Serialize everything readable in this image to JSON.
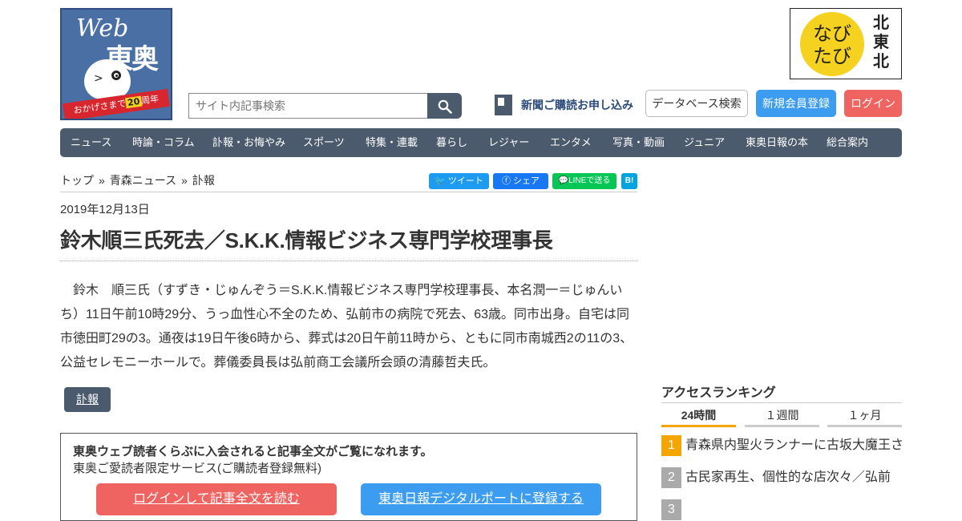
{
  "logo": {
    "web": "Web",
    "name": "東奥",
    "ribbon_before": "おかげさまで",
    "ribbon_num": "20",
    "ribbon_after": "周年"
  },
  "navi_logo": {
    "line1": "なび",
    "line2": "たび",
    "vertical": "北東北"
  },
  "search": {
    "placeholder": "サイト内記事検索"
  },
  "header": {
    "subscribe": "新聞ご購読お申し込み",
    "database": "データベース検索",
    "register": "新規会員登録",
    "login": "ログイン"
  },
  "nav": [
    "ニュース",
    "時論・コラム",
    "訃報・お悔やみ",
    "スポーツ",
    "特集・連載",
    "暮らし",
    "レジャー",
    "エンタメ",
    "写真・動画",
    "ジュニア",
    "東奥日報の本",
    "総合案内"
  ],
  "breadcrumb": {
    "top": "トップ",
    "sep": "»",
    "section": "青森ニュース",
    "current": "訃報"
  },
  "share": {
    "twitter": "ツイート",
    "facebook": "シェア",
    "line": "LINEで送る",
    "hatena": "B!"
  },
  "article": {
    "date": "2019年12月13日",
    "title": "鈴木順三氏死去／S.K.K.情報ビジネス専門学校理事長",
    "body": "鈴木　順三氏（すずき・じゅんぞう＝S.K.K.情報ビジネス専門学校理事長、本名潤一＝じゅんいち）11日午前10時29分、うっ血性心不全のため、弘前市の病院で死去、63歳。同市出身。自宅は同市徳田町29の3。通夜は19日午後6時から、葬式は20日午前11時から、ともに同市南城西2の11の3、公益セレモニーホールで。葬儀委員長は弘前商工会議所会頭の清藤哲夫氏。",
    "tag": "訃報"
  },
  "member": {
    "heading": "東奥ウェブ読者くらぶに入会されると記事全文がご覧になれます。",
    "sub": "東奥ご愛読者限定サービス(ご購読者登録無料)",
    "login_btn": "ログインして記事全文を読む",
    "register_btn": "東奥日報デジタルポートに登録する"
  },
  "ranking": {
    "title": "アクセスランキング",
    "tabs": [
      "24時間",
      "１週間",
      "１ヶ月"
    ],
    "items": [
      {
        "rank": "1",
        "text": "青森県内聖火ランナーに古坂大魔王さん"
      },
      {
        "rank": "2",
        "text": "古民家再生、個性的な店次々／弘前"
      },
      {
        "rank": "3",
        "text": ""
      }
    ]
  },
  "colors": {
    "nav_bg": "#4b5a6d",
    "login": "#ef6461",
    "register": "#3b9cf0",
    "rank_gold": "#f5a500"
  }
}
